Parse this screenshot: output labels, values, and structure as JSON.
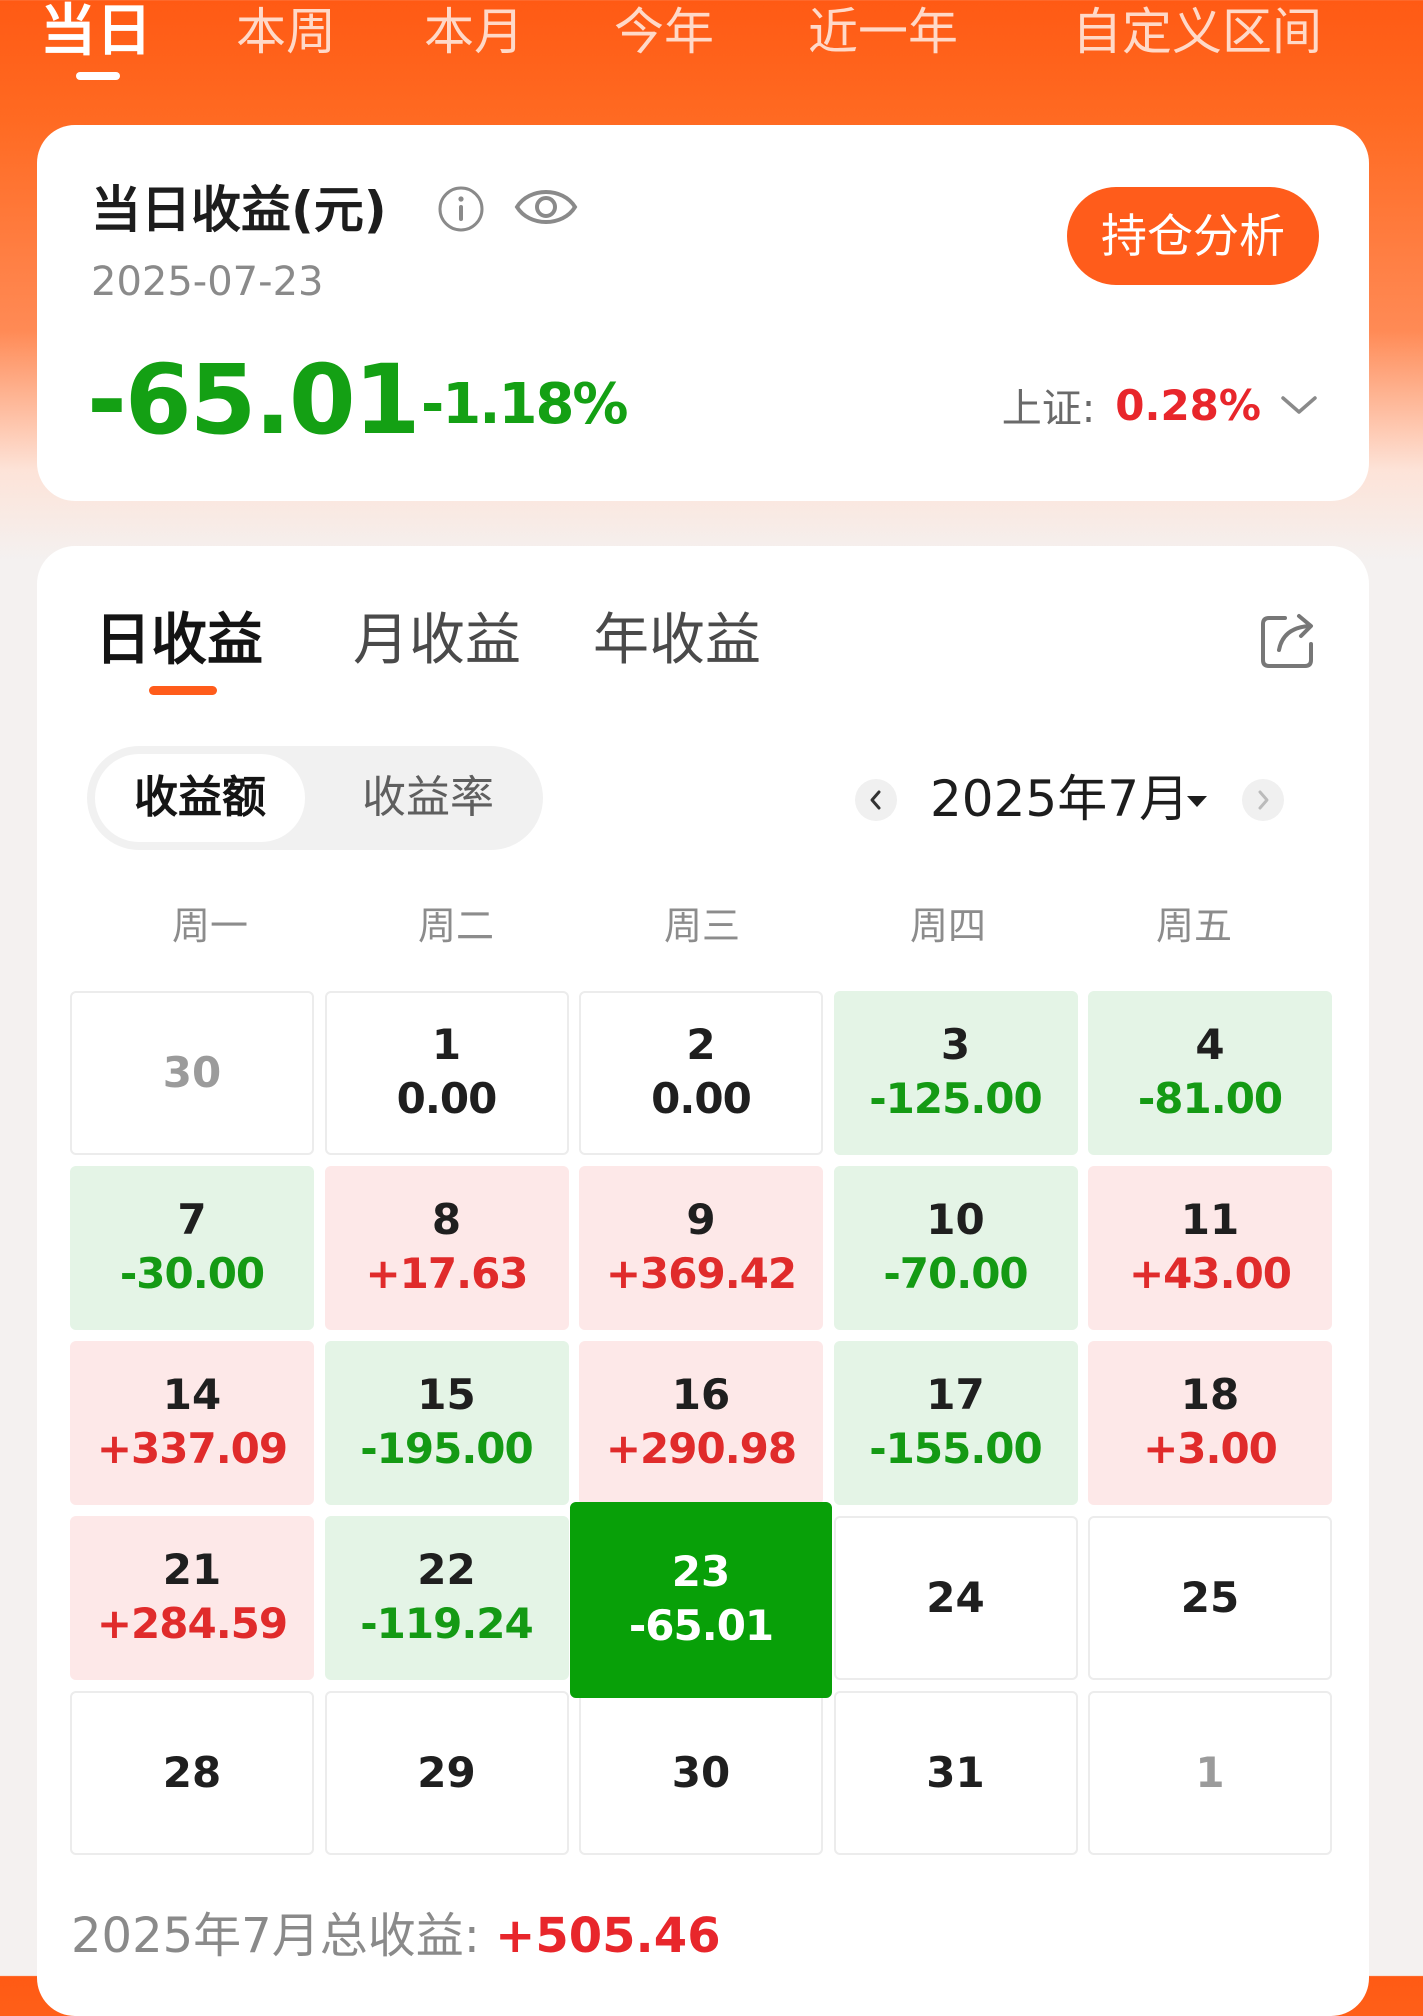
{
  "period_tabs": [
    {
      "label": "当日",
      "active": true
    },
    {
      "label": "本周",
      "active": false
    },
    {
      "label": "本月",
      "active": false
    },
    {
      "label": "今年",
      "active": false
    },
    {
      "label": "近一年",
      "active": false
    },
    {
      "label": "自定义区间",
      "active": false
    }
  ],
  "summary": {
    "title": "当日收益(元)",
    "date": "2025-07-23",
    "amount": "-65.01",
    "percent": "-1.18%",
    "analysis_button": "持仓分析",
    "index_label": "上证:",
    "index_value": "0.28%"
  },
  "calendar_card": {
    "tabs": [
      "日收益",
      "月收益",
      "年收益"
    ],
    "active_tab": "日收益",
    "segments": [
      "收益额",
      "收益率"
    ],
    "active_segment": "收益额",
    "month_label": "2025年7月",
    "weekdays": [
      "周一",
      "周二",
      "周三",
      "周四",
      "周五"
    ],
    "days": [
      {
        "day": "30",
        "value": "",
        "state": "muted"
      },
      {
        "day": "1",
        "value": "0.00",
        "state": "flat"
      },
      {
        "day": "2",
        "value": "0.00",
        "state": "flat"
      },
      {
        "day": "3",
        "value": "-125.00",
        "state": "down"
      },
      {
        "day": "4",
        "value": "-81.00",
        "state": "down"
      },
      {
        "day": "7",
        "value": "-30.00",
        "state": "down"
      },
      {
        "day": "8",
        "value": "+17.63",
        "state": "up"
      },
      {
        "day": "9",
        "value": "+369.42",
        "state": "up"
      },
      {
        "day": "10",
        "value": "-70.00",
        "state": "down"
      },
      {
        "day": "11",
        "value": "+43.00",
        "state": "up"
      },
      {
        "day": "14",
        "value": "+337.09",
        "state": "up"
      },
      {
        "day": "15",
        "value": "-195.00",
        "state": "down"
      },
      {
        "day": "16",
        "value": "+290.98",
        "state": "up"
      },
      {
        "day": "17",
        "value": "-155.00",
        "state": "down"
      },
      {
        "day": "18",
        "value": "+3.00",
        "state": "up"
      },
      {
        "day": "21",
        "value": "+284.59",
        "state": "up"
      },
      {
        "day": "22",
        "value": "-119.24",
        "state": "down"
      },
      {
        "day": "23",
        "value": "-65.01",
        "state": "selected"
      },
      {
        "day": "24",
        "value": "",
        "state": "empty"
      },
      {
        "day": "25",
        "value": "",
        "state": "empty"
      },
      {
        "day": "28",
        "value": "",
        "state": "empty"
      },
      {
        "day": "29",
        "value": "",
        "state": "empty"
      },
      {
        "day": "30",
        "value": "",
        "state": "empty"
      },
      {
        "day": "31",
        "value": "",
        "state": "empty"
      },
      {
        "day": "1",
        "value": "",
        "state": "muted"
      }
    ],
    "total_label": "2025年7月总收益:",
    "total_value": "+505.46"
  },
  "icons": {
    "info": "info-icon",
    "visibility": "eye-icon",
    "index_dropdown": "chevron-down-icon",
    "share": "share-icon",
    "prev_month": "chevron-left-icon",
    "next_month": "chevron-right-icon",
    "month_dropdown": "caret-down-icon"
  },
  "colors": {
    "brand": "#ff5c1b",
    "gain": "#e8262b",
    "loss": "#14a014",
    "gain_bg": "#fde8e8",
    "loss_bg": "#e4f4e6",
    "selected_bg": "#08a008"
  }
}
